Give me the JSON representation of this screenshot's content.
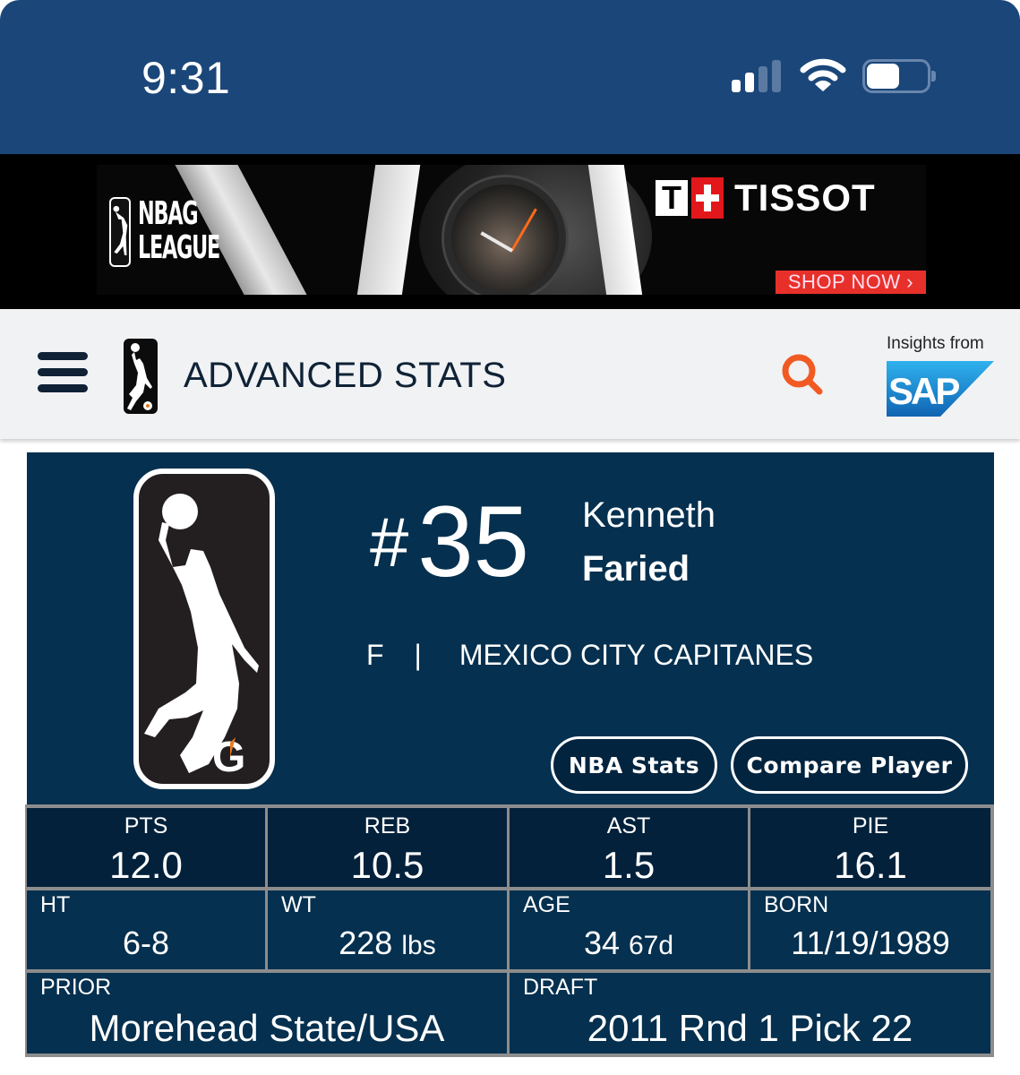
{
  "status_bar": {
    "time": "9:31",
    "signal_bars_active": 2,
    "signal_bars_total": 4,
    "battery_level_fraction": 0.5,
    "icons": [
      "signal-icon",
      "wifi-icon",
      "battery-icon"
    ]
  },
  "ad_banner": {
    "league_logo_text_line1": "NBA",
    "league_logo_text_g": "G",
    "league_logo_text_line2": "LEAGUE",
    "brand_t": "T",
    "brand_name": "TISSOT",
    "cta_label": "SHOP NOW ›",
    "colors": {
      "cta": "#e8302a",
      "cross": "#e2171b"
    }
  },
  "header": {
    "menu_icon": "hamburger-icon",
    "logo_icon": "nba-g-league-logo",
    "title": "ADVANCED STATS",
    "search_icon": "search-icon",
    "sponsor_label": "Insights from",
    "sponsor_logo_text": "SAP",
    "colors": {
      "search": "#f15a22",
      "sap": "#1b8fd9"
    }
  },
  "player": {
    "jersey_hash": "#",
    "jersey_number": "35",
    "first_name": "Kenneth",
    "last_name": "Faried",
    "position": "F",
    "separator": "|",
    "team": "MEXICO CITY CAPITANES",
    "buttons": {
      "nba_stats": "NBA Stats",
      "compare_player": "Compare Player"
    }
  },
  "stats": {
    "headline": [
      {
        "label": "PTS",
        "value": "12.0"
      },
      {
        "label": "REB",
        "value": "10.5"
      },
      {
        "label": "AST",
        "value": "1.5"
      },
      {
        "label": "PIE",
        "value": "16.1"
      }
    ],
    "bio": [
      {
        "label": "HT",
        "value": "6-8",
        "suffix": ""
      },
      {
        "label": "WT",
        "value": "228",
        "suffix": "lbs"
      },
      {
        "label": "AGE",
        "value": "34",
        "suffix": "67d"
      },
      {
        "label": "BORN",
        "value": "11/19/1989",
        "suffix": ""
      }
    ],
    "history": [
      {
        "label": "PRIOR",
        "value": "Morehead State/USA"
      },
      {
        "label": "DRAFT",
        "value": "2011 Rnd 1 Pick 22"
      }
    ]
  },
  "theme": {
    "status_bar_bg": "#1b4679",
    "header_bg": "#f1f2f4",
    "card_bg": "#05304f",
    "headline_cell_bg": "#03213b",
    "grid_line": "#8d8d8d"
  }
}
